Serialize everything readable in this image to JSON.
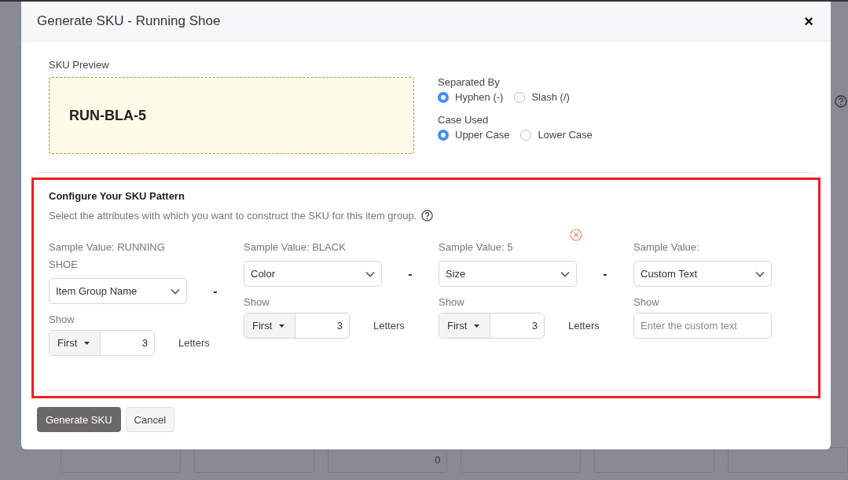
{
  "background": {
    "field_value": "0"
  },
  "dialog": {
    "title": "Generate SKU - Running Shoe",
    "close": "×"
  },
  "preview": {
    "label": "SKU Preview",
    "value": "RUN-BLA-5"
  },
  "options": [
    {
      "label": "Separated By",
      "choices": [
        {
          "label": "Hyphen (-)",
          "selected": true
        },
        {
          "label": "Slash (/)",
          "selected": false
        }
      ]
    },
    {
      "label": "Case Used",
      "choices": [
        {
          "label": "Upper Case",
          "selected": true
        },
        {
          "label": "Lower Case",
          "selected": false
        }
      ]
    }
  ],
  "pattern": {
    "title": "Configure Your SKU Pattern",
    "description": "Select the attributes with which you want to construct the SKU for this item group.",
    "segments": [
      {
        "kind": "letters",
        "sample_label": "Sample Value: RUNNING SHOE",
        "attribute": "Item Group Name",
        "show_label": "Show",
        "mode": "First",
        "count": "3",
        "unit": "Letters",
        "separator": "-",
        "removable": false
      },
      {
        "kind": "letters",
        "sample_label": "Sample Value: BLACK",
        "attribute": "Color",
        "show_label": "Show",
        "mode": "First",
        "count": "3",
        "unit": "Letters",
        "separator": "-",
        "removable": false
      },
      {
        "kind": "letters",
        "sample_label": "Sample Value: 5",
        "attribute": "Size",
        "show_label": "Show",
        "mode": "First",
        "count": "3",
        "unit": "Letters",
        "separator": "-",
        "removable": true
      },
      {
        "kind": "custom",
        "sample_label": "Sample Value:",
        "attribute": "Custom Text",
        "show_label": "Show",
        "placeholder": "Enter the custom text",
        "removable": false
      }
    ]
  },
  "buttons": [
    {
      "label": "Generate SKU",
      "kind": "primary"
    },
    {
      "label": "Cancel",
      "kind": "secondary"
    }
  ]
}
